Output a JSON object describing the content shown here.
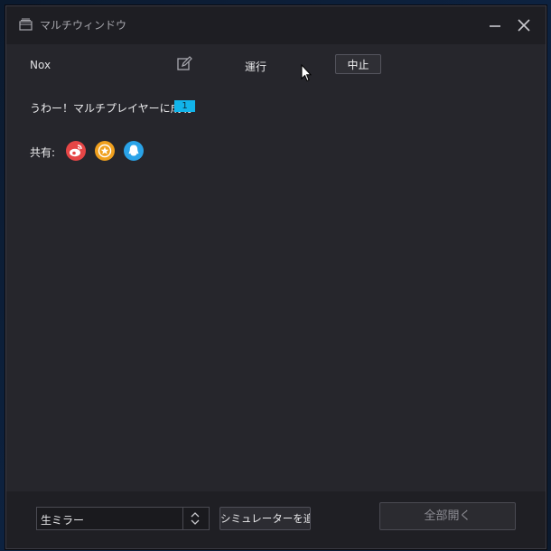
{
  "window": {
    "title": "マルチウィンドウ"
  },
  "instance": {
    "name": "Nox",
    "status": "運行",
    "stop_label": "中止"
  },
  "success": {
    "text": "うわー！マルチプレイヤーに成功:",
    "count": "1"
  },
  "share": {
    "label": "共有:",
    "icons": [
      "weibo-icon",
      "star-icon",
      "qq-icon"
    ]
  },
  "footer": {
    "mirror_select_value": "生ミラー",
    "add_simulator_label": "シミュレーターを追加",
    "open_all_label": "全部開く"
  },
  "colors": {
    "accent": "#12b4ea",
    "weibo": "#e64646",
    "star": "#f0a01e",
    "qq": "#2aa3e8"
  }
}
